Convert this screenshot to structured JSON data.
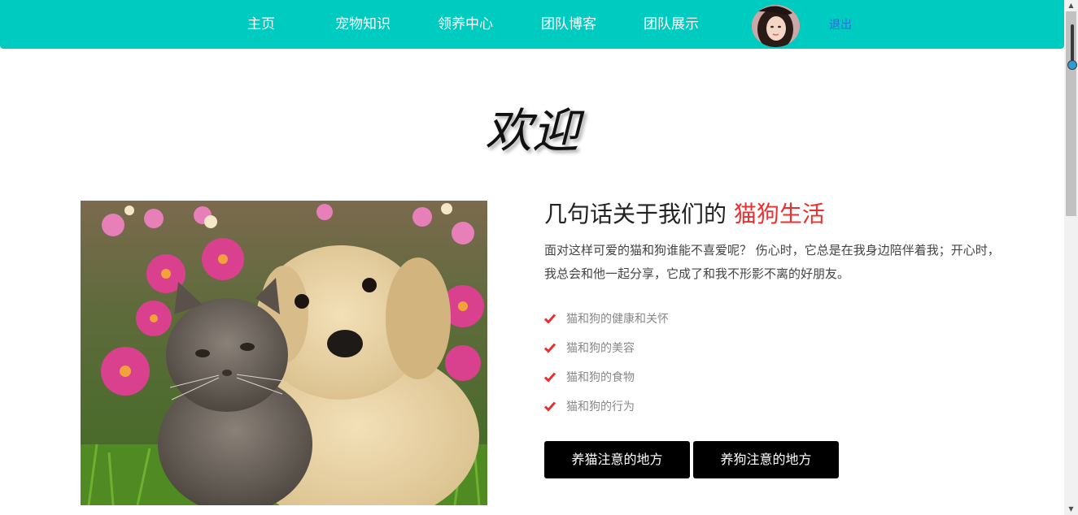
{
  "nav": {
    "items": [
      {
        "label": "主页"
      },
      {
        "label": "宠物知识"
      },
      {
        "label": "领养中心"
      },
      {
        "label": "团队博客"
      },
      {
        "label": "团队展示"
      }
    ],
    "avatar_icon": "user-avatar",
    "logout_label": "退出"
  },
  "hero": {
    "welcome": "欢迎"
  },
  "about": {
    "title_prefix": "几句话关于我们的 ",
    "title_accent": "猫狗生活",
    "paragraph": "面对这样可爱的猫和狗谁能不喜爱呢？ 伤心时，它总是在我身边陪伴着我；开心时，我总会和他一起分享，它成了和我不形影不离的好朋友。",
    "features": [
      {
        "label": "猫和狗的健康和关怀",
        "icon": "check-icon"
      },
      {
        "label": "猫和狗的美容",
        "icon": "check-icon"
      },
      {
        "label": "猫和狗的食物",
        "icon": "check-icon"
      },
      {
        "label": "猫和狗的行为",
        "icon": "check-icon"
      }
    ],
    "buttons": [
      {
        "label": "养猫注意的地方"
      },
      {
        "label": "养狗注意的地方"
      }
    ]
  },
  "colors": {
    "nav_background": "#00cbc0",
    "accent_red": "#ee2f2f",
    "button_background": "#000000",
    "logout_link": "#2a6fd6"
  }
}
